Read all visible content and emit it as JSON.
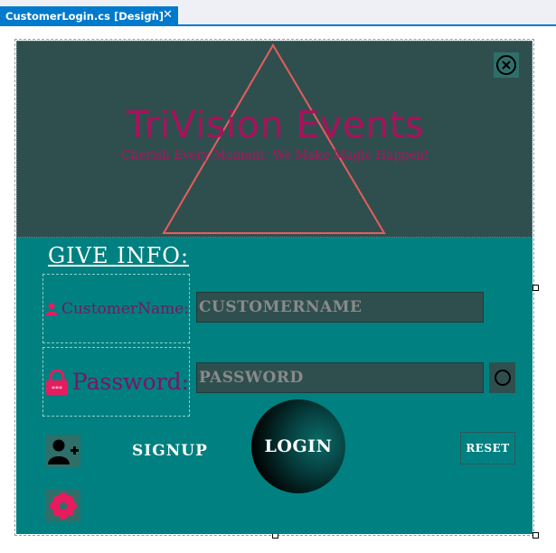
{
  "tab": {
    "title": "CustomerLogin.cs [Design]",
    "pin": "⊣",
    "close": "✕"
  },
  "header": {
    "title": "TriVision Events",
    "tagline": "Cherish Every Moment, We Make Magic Happen!",
    "close_icon": "close-circle-icon"
  },
  "form": {
    "info_title": "GIVE INFO:",
    "customer_label": "CustomerName:",
    "password_label": "Password:",
    "customer_placeholder": "CUSTOMERNAME",
    "password_placeholder": "PASSWORD",
    "signup_label": "SIGNUP",
    "login_label": "LOGIN",
    "reset_label": "RESET"
  },
  "colors": {
    "form_bg": "#008080",
    "header_bg": "#2f4f4f",
    "title": "#a8125a",
    "label": "#7a1660",
    "accent_icon": "#e81b5e",
    "triangle": "#e85c5c"
  }
}
